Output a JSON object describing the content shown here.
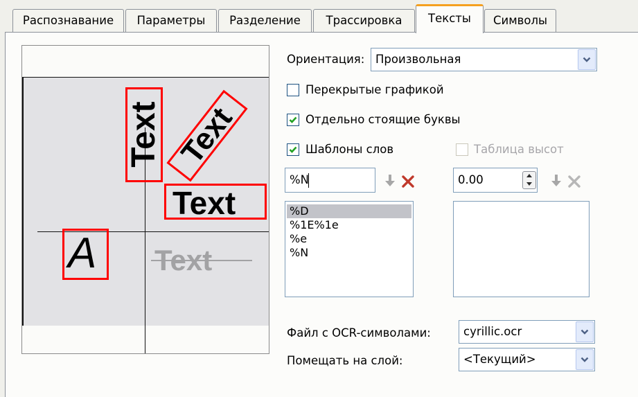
{
  "tabs": [
    {
      "label": "Распознавание",
      "active": false
    },
    {
      "label": "Параметры",
      "active": false
    },
    {
      "label": "Разделение",
      "active": false
    },
    {
      "label": "Трассировка",
      "active": false
    },
    {
      "label": "Тексты",
      "active": true
    },
    {
      "label": "Символы",
      "active": false
    }
  ],
  "preview": {
    "text_vertical": "Text",
    "text_rotated": "Text",
    "text_horizontal": "Text",
    "letter": "A",
    "text_strike": "Text"
  },
  "orientation": {
    "label": "Ориентация:",
    "value": "Произвольная"
  },
  "checkboxes": {
    "overlapped": {
      "label": "Перекрытые графикой",
      "checked": false
    },
    "standalone": {
      "label": "Отдельно стоящие буквы",
      "checked": true
    },
    "word_templates": {
      "label": "Шаблоны слов",
      "checked": true
    },
    "height_table": {
      "label": "Таблица высот",
      "checked": false,
      "disabled": true
    }
  },
  "template_input": {
    "value": "%N"
  },
  "template_list": [
    "%D",
    "%1E%1e",
    "%e",
    "%N"
  ],
  "template_selected_index": 0,
  "height_input": {
    "value": "0.00"
  },
  "height_list": [],
  "ocr_file": {
    "label": "Файл с OCR-символами:",
    "value": "cyrillic.ocr"
  },
  "layer": {
    "label": "Помещать на слой:",
    "value": "<Текущий>"
  },
  "icons": {
    "move_down": "arrow-down-icon",
    "delete": "delete-x-icon",
    "dropdown": "chevron-down-icon",
    "spinner": "spinner-icon",
    "check": "checkmark-icon"
  },
  "colors": {
    "accent_tab": "#f5a020",
    "red_box": "#ff0000",
    "delete": "#c0392b"
  }
}
